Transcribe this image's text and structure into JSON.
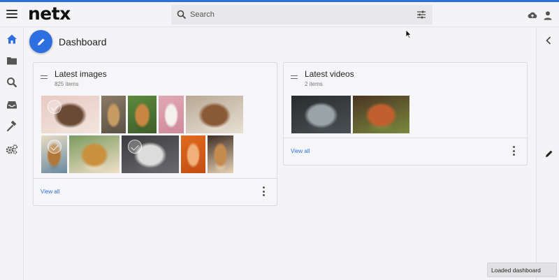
{
  "app": {
    "logo": "netx"
  },
  "search": {
    "placeholder": "Search"
  },
  "page": {
    "title": "Dashboard"
  },
  "images_card": {
    "title": "Latest images",
    "count": "825 items",
    "view_all": "View all",
    "thumbnails": [
      {
        "name": "dog-terrier-pink",
        "colors": [
          "#e8c9c4",
          "#6b4a35",
          "#f2e6dc"
        ]
      },
      {
        "name": "dog-spaniel-street",
        "colors": [
          "#8a7a66",
          "#c79a62",
          "#5b5246"
        ]
      },
      {
        "name": "dog-corgi-grass",
        "colors": [
          "#5d8a3e",
          "#c88640",
          "#3e5e2a"
        ]
      },
      {
        "name": "dog-samoyed-pink",
        "colors": [
          "#e0a9b4",
          "#f4f0ee",
          "#cf8a98"
        ]
      },
      {
        "name": "dog-collie-field",
        "colors": [
          "#b8a894",
          "#8a5a36",
          "#e8e0d4"
        ]
      },
      {
        "name": "dog-beach-running",
        "colors": [
          "#e8dcc4",
          "#b07838",
          "#6a8aa0"
        ]
      },
      {
        "name": "dog-beagle-smile",
        "colors": [
          "#7a9a5e",
          "#c9903e",
          "#f0e0c8"
        ]
      },
      {
        "name": "dog-pitbull-road",
        "colors": [
          "#3c3c3e",
          "#dcdcdc",
          "#6a6a6e"
        ]
      },
      {
        "name": "dog-chihuahua-orange",
        "colors": [
          "#e06a1e",
          "#f0b07a",
          "#c44e12"
        ]
      },
      {
        "name": "dog-beagle-puppy",
        "colors": [
          "#3e2e24",
          "#c48a4e",
          "#e8d2b4"
        ]
      }
    ]
  },
  "videos_card": {
    "title": "Latest videos",
    "count": "2 items",
    "view_all": "View all",
    "thumbnails": [
      {
        "name": "video-machinery",
        "colors": [
          "#2a2c2e",
          "#9aa4a8",
          "#4a5054"
        ]
      },
      {
        "name": "video-red-panda",
        "colors": [
          "#4a3422",
          "#c0602e",
          "#7a8a3e"
        ]
      }
    ]
  },
  "toast": {
    "message": "Loaded dashboard"
  },
  "colors": {
    "accent": "#2d6ee0",
    "nav_active": "#2d6ee0",
    "nav_inactive": "#555555"
  },
  "icons": [
    "menu-icon",
    "search-icon",
    "filter-icon",
    "cloud-upload-icon",
    "user-icon",
    "home-icon",
    "folder-icon",
    "search-nav-icon",
    "inbox-icon",
    "hammer-icon",
    "gears-icon",
    "pencil-icon",
    "chevron-left-icon"
  ]
}
